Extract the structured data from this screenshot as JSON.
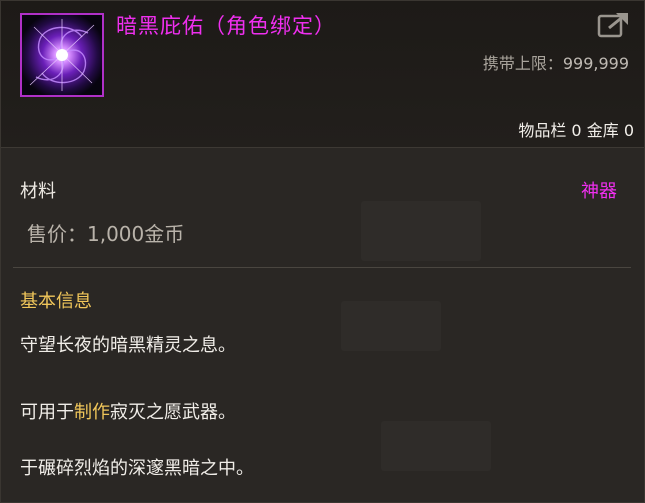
{
  "item": {
    "name": "暗黑庇佑（角色绑定）",
    "icon": "dark-swirl-orb-icon",
    "name_color": "#ef2fef"
  },
  "header": {
    "carry_limit_label": "携带上限：",
    "carry_limit_value": "999,999",
    "inventory_label": "物品栏",
    "inventory_count": "0",
    "bank_label": "金库",
    "bank_count": "0"
  },
  "info": {
    "type": "材料",
    "rarity": "神器",
    "price": "售价：1,000金币"
  },
  "basic_info": {
    "title": "基本信息",
    "line1": "守望长夜的暗黑精灵之息。",
    "line2_prefix": "可用于",
    "line2_keyword": "制作",
    "line2_suffix": "寂灭之愿武器。",
    "line3": "于碾碎烈焰的深邃黑暗之中。"
  },
  "colors": {
    "rarity": "#ef2fef",
    "section_title": "#f0c65a",
    "keyword": "#f0c65a",
    "background": "#2a2724"
  }
}
